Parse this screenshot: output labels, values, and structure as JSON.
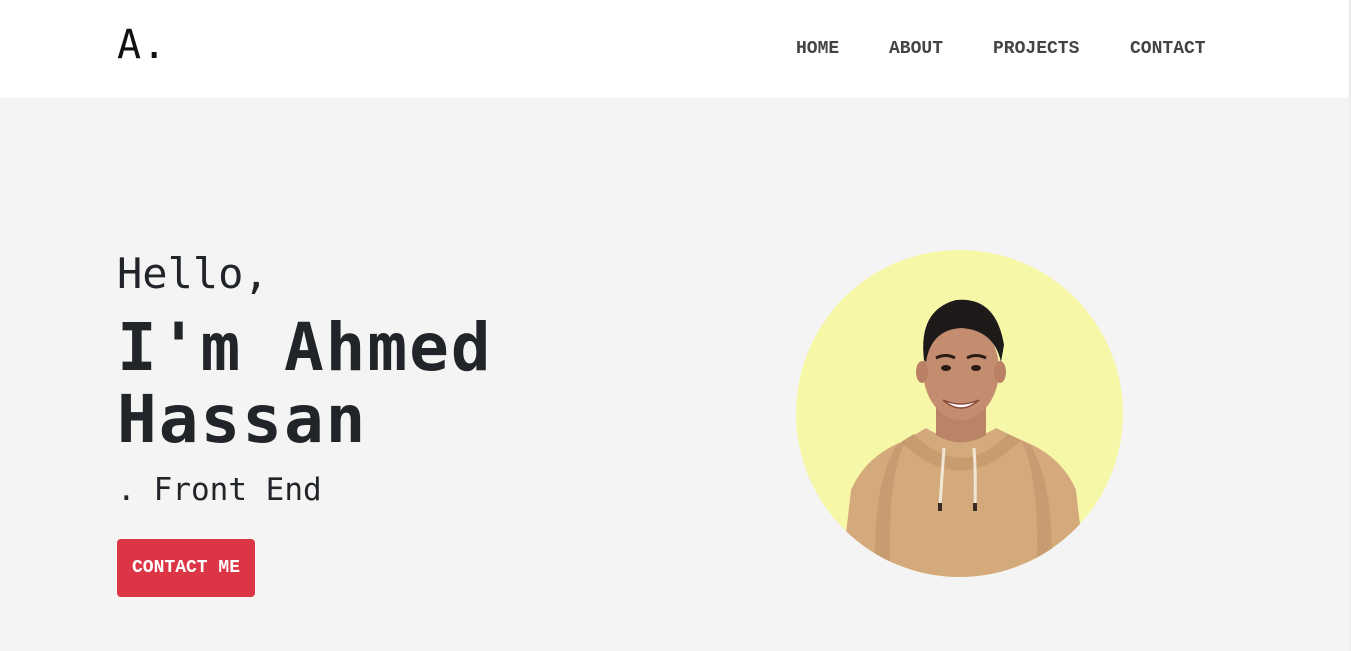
{
  "navbar": {
    "logo": "A.",
    "links": [
      {
        "label": "HOME"
      },
      {
        "label": "ABOUT"
      },
      {
        "label": "PROJECTS"
      },
      {
        "label": "CONTACT"
      }
    ]
  },
  "hero": {
    "greeting": "Hello,",
    "name_line1": "I'm Ahmed",
    "name_line2": "Hassan",
    "role_prefix": ".",
    "role": "Front End",
    "cta_label": "CONTACT ME"
  },
  "colors": {
    "accent": "#dc3545",
    "background": "#f4f4f4",
    "navbar": "#ffffff",
    "avatar_circle": "#f7f7a8"
  }
}
